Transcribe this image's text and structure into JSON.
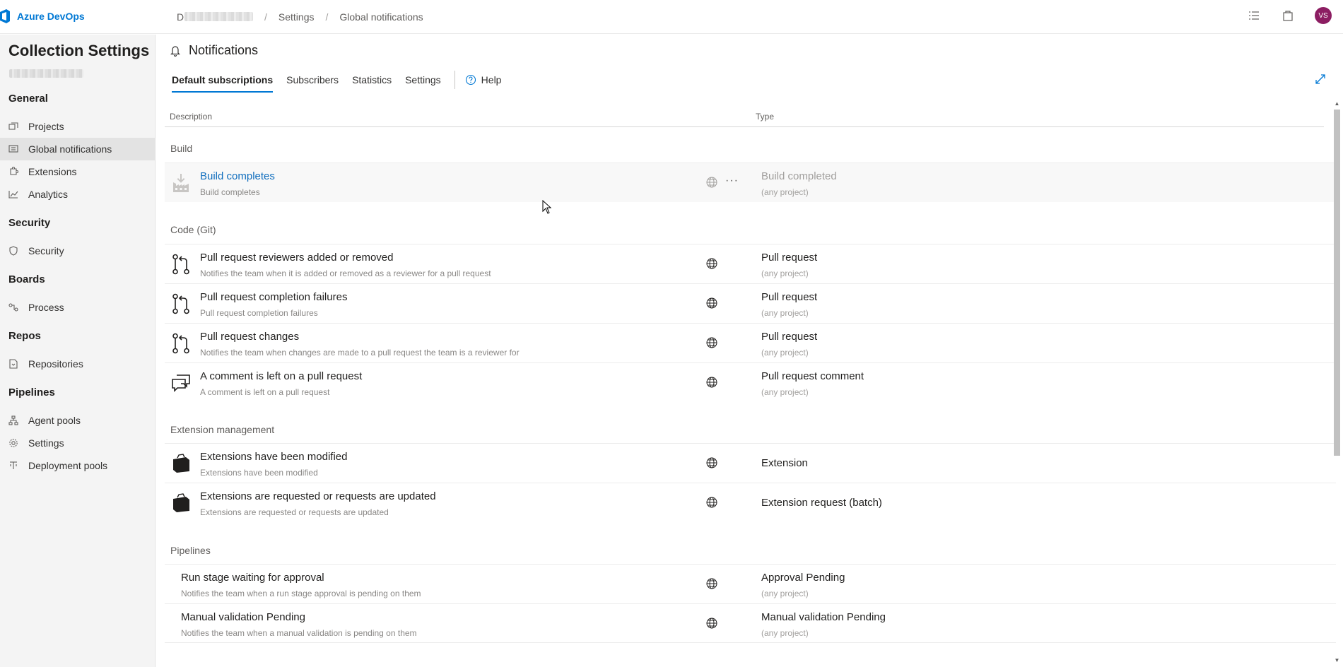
{
  "topbar": {
    "brand": "Azure DevOps",
    "org_initial": "D",
    "breadcrumb_settings": "Settings",
    "breadcrumb_current": "Global notifications",
    "separator": "/",
    "avatar_initials": "VS"
  },
  "sidebar": {
    "title": "Collection Settings",
    "sections": {
      "general": "General",
      "security": "Security",
      "boards": "Boards",
      "repos": "Repos",
      "pipelines": "Pipelines"
    },
    "items": {
      "projects": "Projects",
      "global_notifications": "Global notifications",
      "extensions": "Extensions",
      "analytics": "Analytics",
      "security": "Security",
      "process": "Process",
      "repositories": "Repositories",
      "agent_pools": "Agent pools",
      "settings": "Settings",
      "deployment_pools": "Deployment pools"
    }
  },
  "main": {
    "title": "Notifications",
    "tabs": {
      "default_subscriptions": "Default subscriptions",
      "subscribers": "Subscribers",
      "statistics": "Statistics",
      "settings": "Settings",
      "help": "Help"
    },
    "columns": {
      "description": "Description",
      "type": "Type"
    },
    "groups": {
      "build": "Build",
      "code": "Code (Git)",
      "extension": "Extension management",
      "pipelines": "Pipelines"
    },
    "rows": [
      {
        "title": "Build completes",
        "subtitle": "Build completes",
        "type": "Build completed",
        "scope": "(any project)",
        "icon": "build-icon"
      },
      {
        "title": "Pull request reviewers added or removed",
        "subtitle": "Notifies the team when it is added or removed as a reviewer for a pull request",
        "type": "Pull request",
        "scope": "(any project)",
        "icon": "pull-request-icon"
      },
      {
        "title": "Pull request completion failures",
        "subtitle": "Pull request completion failures",
        "type": "Pull request",
        "scope": "(any project)",
        "icon": "pull-request-icon"
      },
      {
        "title": "Pull request changes",
        "subtitle": "Notifies the team when changes are made to a pull request the team is a reviewer for",
        "type": "Pull request",
        "scope": "(any project)",
        "icon": "pull-request-icon"
      },
      {
        "title": "A comment is left on a pull request",
        "subtitle": "A comment is left on a pull request",
        "type": "Pull request comment",
        "scope": "(any project)",
        "icon": "comment-icon"
      },
      {
        "title": "Extensions have been modified",
        "subtitle": "Extensions have been modified",
        "type": "Extension",
        "scope": "",
        "icon": "shopping-bag-icon"
      },
      {
        "title": "Extensions are requested or requests are updated",
        "subtitle": "Extensions are requested or requests are updated",
        "type": "Extension request (batch)",
        "scope": "",
        "icon": "shopping-bag-icon"
      },
      {
        "title": "Run stage waiting for approval",
        "subtitle": "Notifies the team when a run stage approval is pending on them",
        "type": "Approval Pending",
        "scope": "(any project)",
        "icon": ""
      },
      {
        "title": "Manual validation Pending",
        "subtitle": "Notifies the team when a manual validation is pending on them",
        "type": "Manual validation Pending",
        "scope": "(any project)",
        "icon": ""
      }
    ],
    "more_label": "···"
  }
}
